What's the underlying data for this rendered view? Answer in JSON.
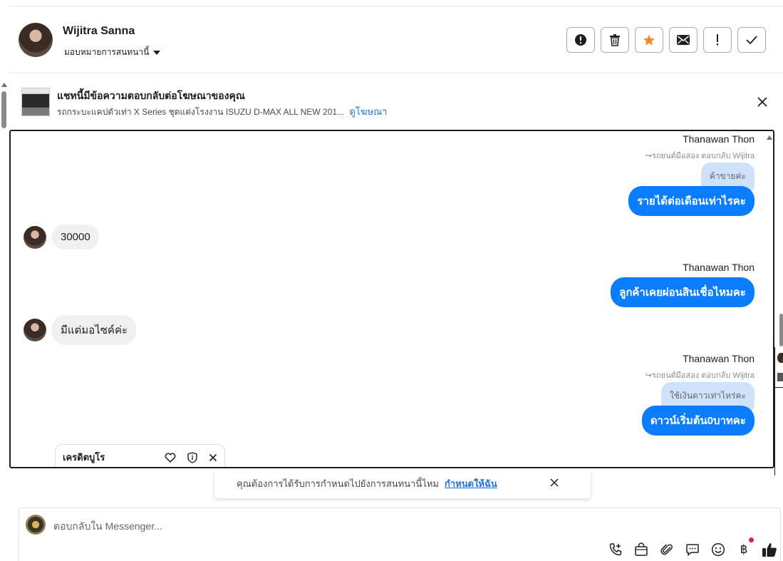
{
  "header": {
    "contact_name": "Wijitra Sanna",
    "assign_label": "มอบหมายการสนทนานี้",
    "actions": [
      {
        "icon": "alert-circle-icon",
        "name": "spam-button"
      },
      {
        "icon": "trash-icon",
        "name": "delete-button"
      },
      {
        "icon": "star-icon",
        "name": "star-button"
      },
      {
        "icon": "envelope-icon",
        "name": "mark-unread-button"
      },
      {
        "icon": "exclamation-icon",
        "name": "follow-up-button"
      },
      {
        "icon": "check-icon",
        "name": "done-button"
      }
    ],
    "star_color": "#f28c28"
  },
  "ad_banner": {
    "title": "แชทนี้มีข้อความตอบกลับต่อโฆษณาของคุณ",
    "subtitle": "รถกระบะแคปตัวเท่า X Series ชุดแต่งโรงงาน ISUZU D-MAX ALL NEW 201...",
    "link": "ดูโฆษณา"
  },
  "messages": {
    "group1": {
      "sender": "Thanawan Thon",
      "reply_meta": "↪รถยนต์มือสอง ตอบกลับ Wijitra",
      "quoted": "ค้าขายค่ะ",
      "text": "รายได้ต่อเดือนเท่าไรคะ"
    },
    "incoming1": "30000",
    "group2": {
      "sender": "Thanawan Thon",
      "text": "ลูกค้าเคยผ่อนสินเชื่อไหมคะ"
    },
    "incoming2": "มีแต่มอไซค์ค่ะ",
    "group3": {
      "sender": "Thanawan Thon",
      "reply_meta": "↪รถยนต์มือสอง ตอบกลับ Wijitra",
      "quoted": "ใช้เงินดาวเท่าไหร่คะ",
      "text": "ดาวน์เริ่มต้น0บาทคะ"
    }
  },
  "credit_tab": {
    "name": "เครดิตบูโร"
  },
  "reminder": {
    "text": "คุณต้องการได้รับการกำหนดไปยังการสนทนานี้ไหม",
    "link": "กำหนดให้ฉัน"
  },
  "composer": {
    "placeholder": "ตอบกลับใน Messenger...",
    "tools": [
      "phone-plus-icon",
      "shopping-bag-icon",
      "paperclip-icon",
      "saved-reply-icon",
      "emoji-icon",
      "baht-icon",
      "thumbs-up-icon"
    ],
    "baht_symbol": "฿",
    "accent": "#0a7cff"
  }
}
